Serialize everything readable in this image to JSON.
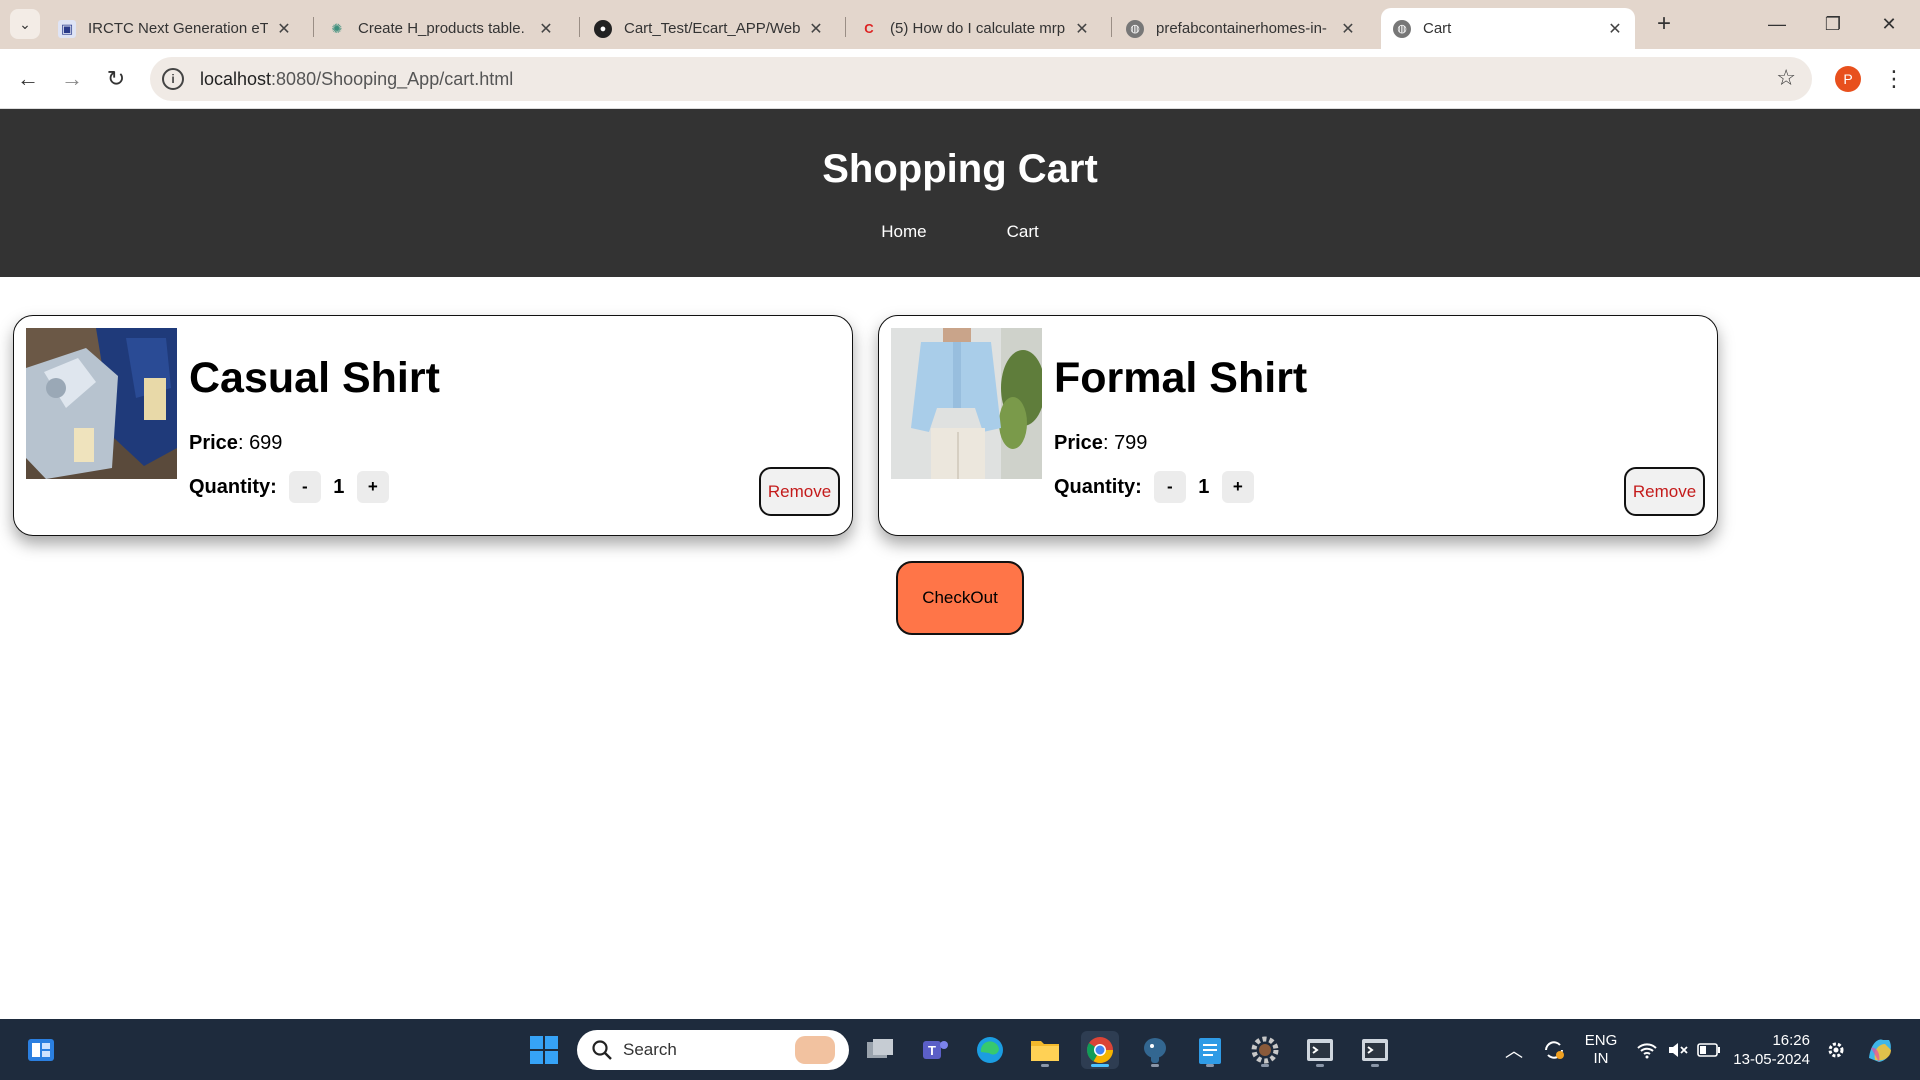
{
  "browser": {
    "tabs": [
      {
        "title": "IRCTC Next Generation eTi",
        "icon": "irctc-icon"
      },
      {
        "title": "Create H_products table.",
        "icon": "chatgpt-icon"
      },
      {
        "title": "Cart_Test/Ecart_APP/WebC",
        "icon": "github-icon"
      },
      {
        "title": "(5) How do I calculate mrp",
        "icon": "quora-icon"
      },
      {
        "title": "prefabcontainerhomes-in-",
        "icon": "globe-icon"
      },
      {
        "title": "Cart",
        "icon": "globe-icon",
        "active": true
      }
    ],
    "url_host": "localhost",
    "url_rest": ":8080/Shooping_App/cart.html",
    "profile_initial": "P"
  },
  "site": {
    "title": "Shopping Cart",
    "nav": [
      "Home",
      "Cart"
    ]
  },
  "cart": {
    "price_label": "Price",
    "quantity_label": "Quantity:",
    "minus": "-",
    "plus": "+",
    "remove_label": "Remove",
    "items": [
      {
        "name": "Casual Shirt",
        "price": "699",
        "quantity": "1"
      },
      {
        "name": "Formal Shirt",
        "price": "799",
        "quantity": "1"
      }
    ],
    "checkout_label": "CheckOut"
  },
  "taskbar": {
    "search_label": "Search",
    "lang_top": "ENG",
    "lang_bottom": "IN",
    "time": "16:26",
    "date": "13-05-2024"
  },
  "colors": {
    "header_bg": "#333333",
    "checkout_bg": "#ff7548",
    "remove_text": "#c41b1b",
    "taskbar_bg": "#1e2b3d"
  }
}
